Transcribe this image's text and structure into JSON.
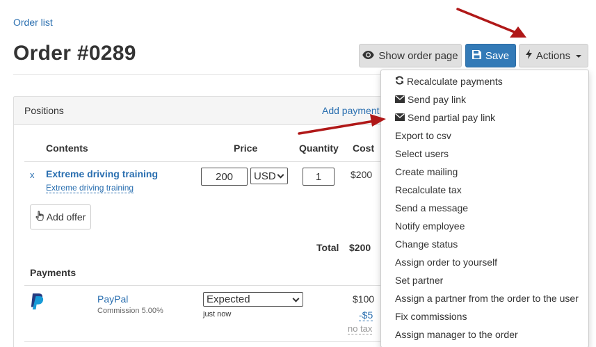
{
  "breadcrumb": "Order list",
  "title": "Order #0289",
  "toolbar": {
    "show_order_page": "Show order page",
    "save": "Save",
    "actions": "Actions"
  },
  "positions": {
    "heading": "Positions",
    "add_payment": "Add payment",
    "columns": [
      "Contents",
      "Price",
      "Quantity",
      "Cost"
    ],
    "rows": [
      {
        "remove": "x",
        "name": "Extreme driving training",
        "subname": "Extreme driving training",
        "price": "200",
        "currency": "USD",
        "quantity": "1",
        "cost": "$200"
      }
    ],
    "add_offer": "Add offer",
    "total_label": "Total",
    "total_value": "$200"
  },
  "payments": {
    "heading": "Payments",
    "items": [
      {
        "method": "PayPal",
        "commission": "Commission 5.00%",
        "status": "Expected",
        "time": "just now",
        "amount": "$100",
        "fee": "-$5",
        "tax": "no tax"
      }
    ]
  },
  "actions_menu": [
    {
      "label": "Recalculate payments",
      "icon": "refresh-icon"
    },
    {
      "label": "Send pay link",
      "icon": "envelope-icon"
    },
    {
      "label": "Send partial pay link",
      "icon": "envelope-icon"
    },
    {
      "label": "Export to csv"
    },
    {
      "label": "Select users"
    },
    {
      "label": "Create mailing"
    },
    {
      "label": "Recalculate tax"
    },
    {
      "label": "Send a message"
    },
    {
      "label": "Notify employee"
    },
    {
      "label": "Change status"
    },
    {
      "label": "Assign order to yourself"
    },
    {
      "label": "Set partner"
    },
    {
      "label": "Assign a partner from the order to the user"
    },
    {
      "label": "Fix commissions"
    },
    {
      "label": "Assign manager to the order"
    }
  ],
  "colors": {
    "primary": "#337ab7",
    "link": "#2a6fb0",
    "annotation_arrow": "#b01818"
  }
}
